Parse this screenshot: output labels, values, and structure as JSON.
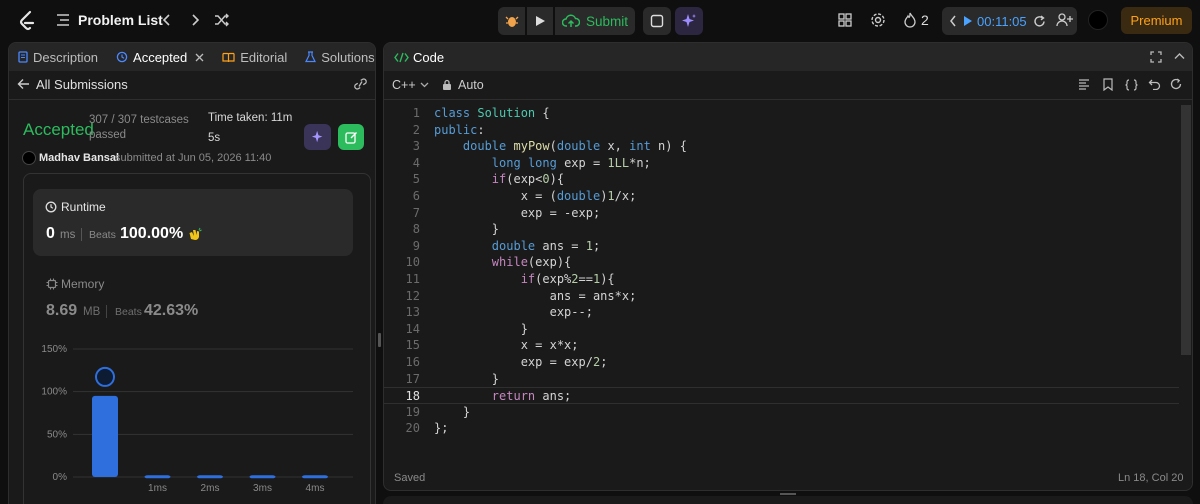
{
  "topbar": {
    "title": "Problem List",
    "submit_label": "Submit",
    "streak": "2",
    "timer": "00:11:05",
    "premium": "Premium"
  },
  "left": {
    "tabs": [
      {
        "label": "Description"
      },
      {
        "label": "Accepted"
      },
      {
        "label": "Editorial"
      },
      {
        "label": "Solutions"
      }
    ],
    "back_label": "All Submissions",
    "status": "Accepted",
    "testcases": "307 / 307 testcases",
    "testcases2": "passed",
    "time_taken": "Time taken: 11m",
    "time_taken2": "5s",
    "author": "Madhav Bansal",
    "submitted": "submitted at Jun 05, 2026 11:40",
    "runtime": {
      "label": "Runtime",
      "value": "0",
      "unit": "ms",
      "beats_label": "Beats",
      "beats": "100.00%"
    },
    "memory": {
      "label": "Memory",
      "value": "8.69",
      "unit": "MB",
      "beats_label": "Beats",
      "beats": "42.63%"
    }
  },
  "chart_data": {
    "type": "bar",
    "categories": [
      "",
      "1ms",
      "2ms",
      "3ms",
      "4ms"
    ],
    "values": [
      95,
      2,
      2,
      2,
      2
    ],
    "ylim": [
      0,
      150
    ],
    "yticks": [
      "0%",
      "50%",
      "100%",
      "150%"
    ],
    "highlight_index": 0,
    "grid": true,
    "bar_color": "#2f6fdd"
  },
  "editor": {
    "title": "Code",
    "language": "C++",
    "mode": "Auto",
    "status": "Saved",
    "cursor": "Ln 18, Col 20",
    "current_line": 18,
    "lines": [
      "class Solution {",
      "public:",
      "    double myPow(double x, int n) {",
      "        long long exp = 1LL*n;",
      "        if(exp<0){",
      "            x = (double)1/x;",
      "            exp = -exp;",
      "        }",
      "        double ans = 1;",
      "        while(exp){",
      "            if(exp%2==1){",
      "                ans = ans*x;",
      "                exp--;",
      "            }",
      "            x = x*x;",
      "            exp = exp/2;",
      "        }",
      "        return ans;",
      "    }",
      "};"
    ]
  },
  "colors": {
    "accent": "#2cbb5d",
    "brand": "#ffa116",
    "bar": "#2f6fdd"
  }
}
